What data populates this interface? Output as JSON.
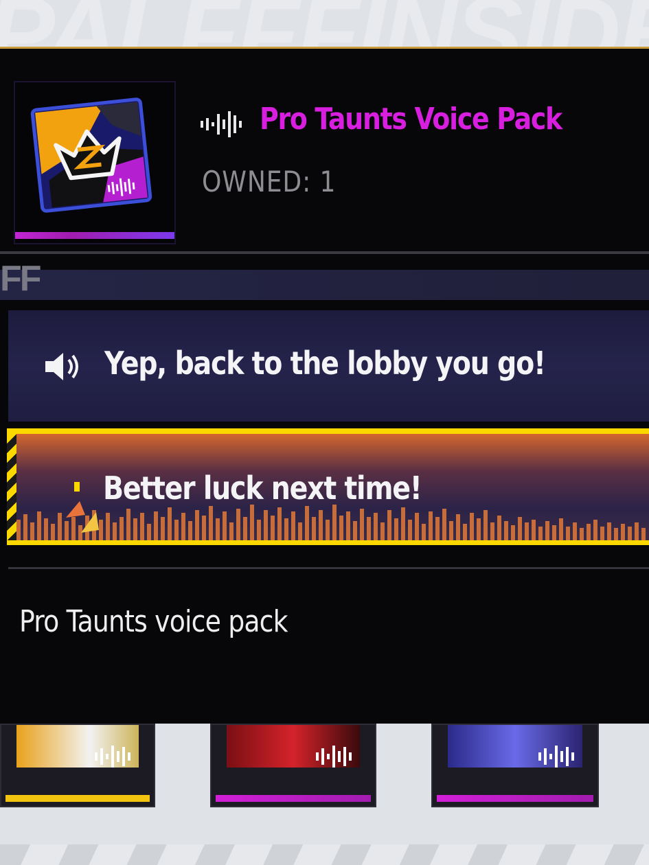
{
  "background": {
    "watermark_text": "PALFFFINSIDE",
    "color": "#dfe2e6"
  },
  "item": {
    "title": "Pro Taunts Voice Pack",
    "owned_label": "OWNED: 1",
    "title_color": "#d81fe0",
    "icon": "voice-pack-crown-icon",
    "rarity_bar_color": "#c026d3"
  },
  "section_tag": "FF",
  "voice_lines": [
    {
      "text": "Yep, back to the lobby you go!",
      "icon": "speaker-icon",
      "selected": false
    },
    {
      "text": "Better luck next time!",
      "icon": "playing-indicator",
      "selected": true,
      "accent": "#fbd800"
    }
  ],
  "description": "Pro Taunts voice pack",
  "related_cards": [
    {
      "icon": "voice-wave-icon",
      "bar_color": "#f2c40f"
    },
    {
      "icon": "voice-wave-icon",
      "bar_color": "#c026d3"
    },
    {
      "icon": "voice-wave-icon",
      "bar_color": "#c026d3"
    }
  ]
}
